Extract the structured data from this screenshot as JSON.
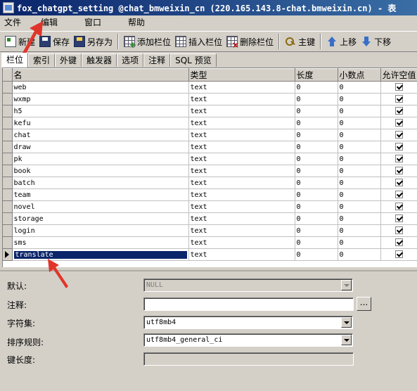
{
  "window": {
    "title": "fox_chatgpt_setting @chat_bmweixin_cn (220.165.143.8-chat.bmweixin.cn) - 表"
  },
  "menu": [
    "文件",
    "编辑",
    "窗口",
    "帮助"
  ],
  "toolbar": {
    "new": "新建",
    "save": "保存",
    "save_as": "另存为",
    "add_field": "添加栏位",
    "insert_field": "插入栏位",
    "delete_field": "删除栏位",
    "primary_key": "主键",
    "move_up": "上移",
    "move_down": "下移"
  },
  "tabs": [
    "栏位",
    "索引",
    "外键",
    "触发器",
    "选项",
    "注释",
    "SQL 预览"
  ],
  "grid": {
    "columns": [
      "名",
      "类型",
      "长度",
      "小数点",
      "允许空值"
    ],
    "rows": [
      {
        "name": "web",
        "type": "text",
        "length": "0",
        "decimals": "0",
        "nullable": true
      },
      {
        "name": "wxmp",
        "type": "text",
        "length": "0",
        "decimals": "0",
        "nullable": true
      },
      {
        "name": "h5",
        "type": "text",
        "length": "0",
        "decimals": "0",
        "nullable": true
      },
      {
        "name": "kefu",
        "type": "text",
        "length": "0",
        "decimals": "0",
        "nullable": true
      },
      {
        "name": "chat",
        "type": "text",
        "length": "0",
        "decimals": "0",
        "nullable": true
      },
      {
        "name": "draw",
        "type": "text",
        "length": "0",
        "decimals": "0",
        "nullable": true
      },
      {
        "name": "pk",
        "type": "text",
        "length": "0",
        "decimals": "0",
        "nullable": true
      },
      {
        "name": "book",
        "type": "text",
        "length": "0",
        "decimals": "0",
        "nullable": true
      },
      {
        "name": "batch",
        "type": "text",
        "length": "0",
        "decimals": "0",
        "nullable": true
      },
      {
        "name": "team",
        "type": "text",
        "length": "0",
        "decimals": "0",
        "nullable": true
      },
      {
        "name": "novel",
        "type": "text",
        "length": "0",
        "decimals": "0",
        "nullable": true
      },
      {
        "name": "storage",
        "type": "text",
        "length": "0",
        "decimals": "0",
        "nullable": true
      },
      {
        "name": "login",
        "type": "text",
        "length": "0",
        "decimals": "0",
        "nullable": true
      },
      {
        "name": "sms",
        "type": "text",
        "length": "0",
        "decimals": "0",
        "nullable": true
      },
      {
        "name": "translate",
        "type": "text",
        "length": "0",
        "decimals": "0",
        "nullable": true
      }
    ],
    "selected_row": 14
  },
  "properties": {
    "default_label": "默认:",
    "default_value": "NULL",
    "comment_label": "注释:",
    "comment_value": "",
    "charset_label": "字符集:",
    "charset_value": "utf8mb4",
    "collation_label": "排序规则:",
    "collation_value": "utf8mb4_general_ci",
    "key_length_label": "键长度:",
    "key_length_value": ""
  },
  "colors": {
    "title_bar": "#0a246a",
    "selection": "#0a246a",
    "annotation_arrow": "#e0352b"
  }
}
